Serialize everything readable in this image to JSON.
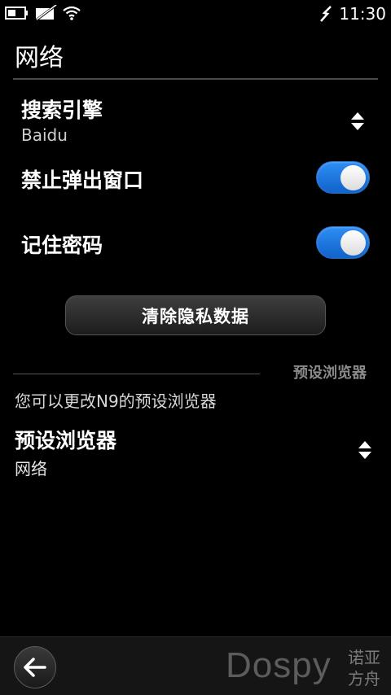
{
  "status": {
    "time": "11:30",
    "icons": [
      "battery-icon",
      "no-sim-icon",
      "wifi-icon",
      "usb-icon"
    ]
  },
  "page": {
    "title": "网络"
  },
  "settings": {
    "search_engine": {
      "label": "搜索引擎",
      "value": "Baidu"
    },
    "popup_blocker": {
      "label": "禁止弹出窗口",
      "enabled": true
    },
    "remember_password": {
      "label": "记住密码",
      "enabled": true
    },
    "clear_button": "清除隐私数据"
  },
  "default_browser_section": {
    "label": "预设浏览器",
    "description": "您可以更改N9的预设浏览器",
    "setting": {
      "label": "预设浏览器",
      "value": "网络"
    }
  },
  "toolbar": {
    "back_icon": "back-arrow-icon",
    "watermark": "Dospy",
    "watermark_cn_line1": "诺亚",
    "watermark_cn_line2": "方舟"
  },
  "colors": {
    "accent": "#1f7de6",
    "background": "#000000"
  }
}
